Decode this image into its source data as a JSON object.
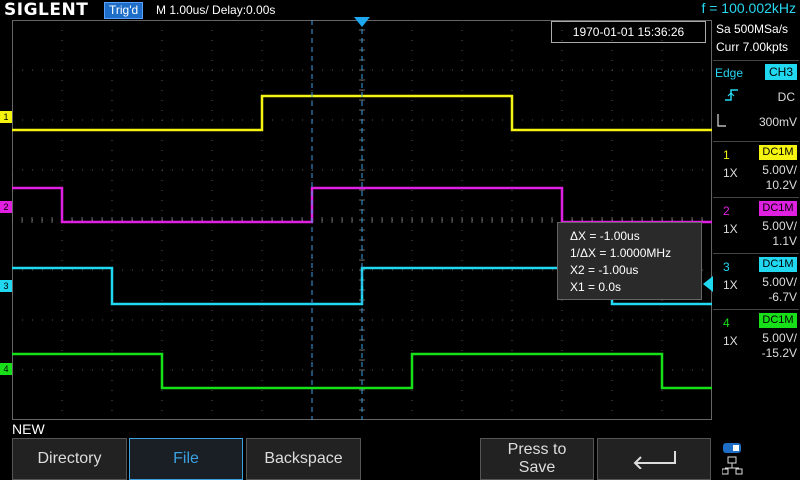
{
  "header": {
    "logo": "SIGLENT",
    "trigger_status": "Trig'd",
    "timebase": "M 1.00us/  Delay:0.00s",
    "frequency": "f = 100.002kHz"
  },
  "datetime": "1970-01-01 15:36:26",
  "acquisition": {
    "sample_rate": "Sa 500MSa/s",
    "memory": "Curr 7.00kpts"
  },
  "trigger": {
    "type": "Edge",
    "source": "CH3",
    "coupling": "DC",
    "level": "300mV",
    "slope_icon": "rising-edge-icon"
  },
  "channels": [
    {
      "num": "1",
      "coupling": "DC1M",
      "probe": "1X",
      "scale": "5.00V/",
      "offset": "10.2V",
      "color": "#f4f410"
    },
    {
      "num": "2",
      "coupling": "DC1M",
      "probe": "1X",
      "scale": "5.00V/",
      "offset": "1.1V",
      "color": "#e020e0"
    },
    {
      "num": "3",
      "coupling": "DC1M",
      "probe": "1X",
      "scale": "5.00V/",
      "offset": "-6.7V",
      "color": "#20d8f0"
    },
    {
      "num": "4",
      "coupling": "DC1M",
      "probe": "1X",
      "scale": "5.00V/",
      "offset": "-15.2V",
      "color": "#18e018"
    }
  ],
  "cursor": {
    "dx": "ΔX = -1.00us",
    "inv_dx": "1/ΔX = 1.0000MHz",
    "x2": "X2 = -1.00us",
    "x1": "X1 = 0.0s"
  },
  "filename": "NEW",
  "softkeys": {
    "directory": "Directory",
    "file": "File",
    "backspace": "Backspace",
    "press_to_save": "Press to Save",
    "enter_icon": "return-arrow-icon",
    "settings_icon": "network-icon"
  },
  "waveforms": {
    "time_axis_divisions": 14,
    "ch1": {
      "transitions_div": [
        5.0,
        10.0
      ],
      "start_level": "low"
    },
    "ch2": {
      "transitions_div": [
        1.0,
        6.0,
        11.0
      ],
      "start_level": "high"
    },
    "ch3": {
      "transitions_div": [
        2.0,
        7.0,
        12.0
      ],
      "start_level": "high"
    },
    "ch4": {
      "transitions_div": [
        3.0,
        8.0,
        13.0
      ],
      "start_level": "high"
    }
  }
}
